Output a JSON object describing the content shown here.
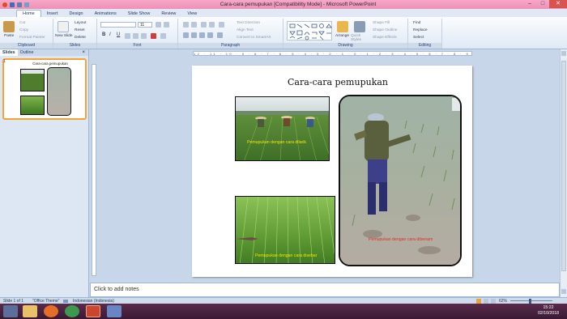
{
  "window": {
    "title": "Cara-cara pemupukan [Compatibility Mode] - Microsoft PowerPoint",
    "minimize": "–",
    "maximize": "□",
    "close": "✕"
  },
  "tabs": [
    "Home",
    "Insert",
    "Design",
    "Animations",
    "Slide Show",
    "Review",
    "View"
  ],
  "ribbon": {
    "clipboard": {
      "label": "Clipboard",
      "paste": "Paste",
      "cut": "Cut",
      "copy": "Copy",
      "format_painter": "Format Painter"
    },
    "slides": {
      "label": "Slides",
      "new_slide": "New Slide",
      "layout": "Layout",
      "reset": "Reset",
      "delete": "Delete"
    },
    "font": {
      "label": "Font",
      "font_size": "11"
    },
    "paragraph": {
      "label": "Paragraph",
      "text_direction": "Text Direction",
      "align_text": "Align Text",
      "convert_smartart": "Convert to SmartArt"
    },
    "drawing": {
      "label": "Drawing",
      "arrange": "Arrange",
      "quick_styles": "Quick Styles",
      "shape_fill": "Shape Fill",
      "shape_outline": "Shape Outline",
      "shape_effects": "Shape Effects"
    },
    "editing": {
      "label": "Editing",
      "find": "Find",
      "replace": "Replace",
      "select": "Select"
    }
  },
  "panel": {
    "tab_slides": "Slides",
    "tab_outline": "Outline",
    "close": "×",
    "slide_number": "1"
  },
  "ruler": "12 · 11 · 10 · 9 · 8 · 7 · 6 · 5 · 4 · 3 · 2 · 1 · 0 · 1 · 2 · 3 · 4 · 5 · 6 · 7 · 8 · 9 · 10 · 11 · 12",
  "slide": {
    "title": "Cara-cara pemupukan",
    "caption_top_left": "Pemupukan dengan cara dilarik",
    "caption_bottom_left": "Pemupukan dengan cara disebar",
    "caption_right": "Pemupukan dengan cara dibenam"
  },
  "notes_placeholder": "Click to add notes",
  "status": {
    "slide": "Slide 1 of 1",
    "theme": "\"Office Theme\"",
    "language": "Indonesian (Indonesia)",
    "zoom": "62%"
  },
  "taskbar": {
    "time": "15:22",
    "date": "02/10/2018"
  },
  "colors": {
    "title_bar": "#f08fb6",
    "ribbon": "#dfe9f5",
    "caption_yellow": "#f2e600",
    "caption_red": "#e0301e"
  }
}
